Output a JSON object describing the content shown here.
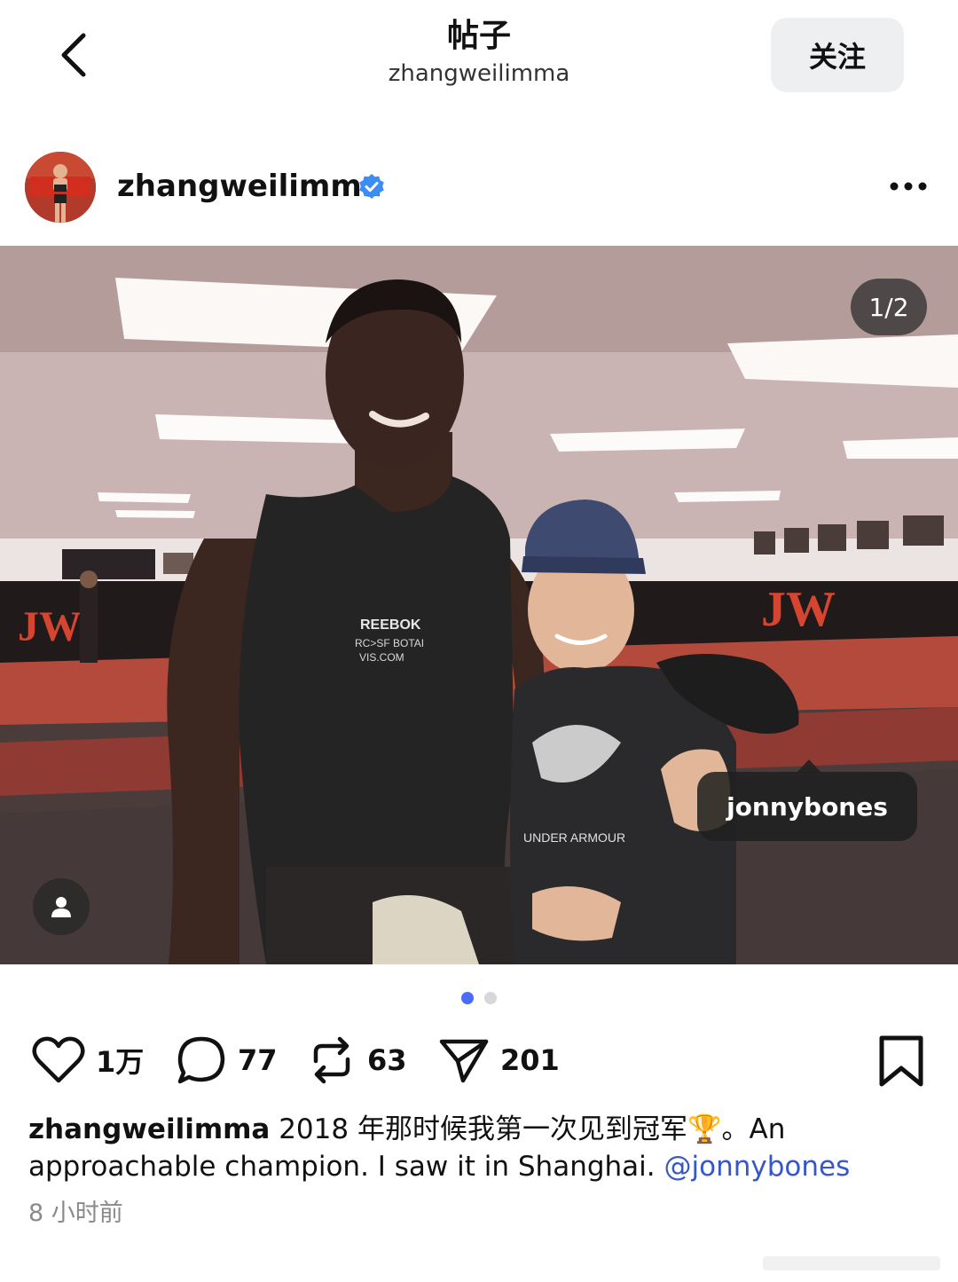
{
  "header": {
    "title": "帖子",
    "subtitle": "zhangweilimma",
    "follow_label": "关注",
    "back_icon": "chevron-left-icon"
  },
  "post": {
    "author": "zhangweilimma",
    "verified": true,
    "more_icon": "more-horizontal-icon",
    "image_counter": "1/2",
    "tagged_user": "jonnybones",
    "carousel": {
      "total": 2,
      "active": 1
    },
    "actions": {
      "likes": "1万",
      "comments": "77",
      "reposts": "63",
      "shares": "201"
    },
    "caption": {
      "author": "zhangweilimma",
      "text": " 2018 年那时候我第一次见到冠军🏆。An approachable champion. I saw it in Shanghai. ",
      "mention": "@jonnybones"
    },
    "timestamp": "8 小时前"
  },
  "colors": {
    "accent": "#4a6cf7",
    "verified": "#3b8cf5",
    "mention": "#3557c9",
    "follow_bg": "#eeeff1"
  }
}
